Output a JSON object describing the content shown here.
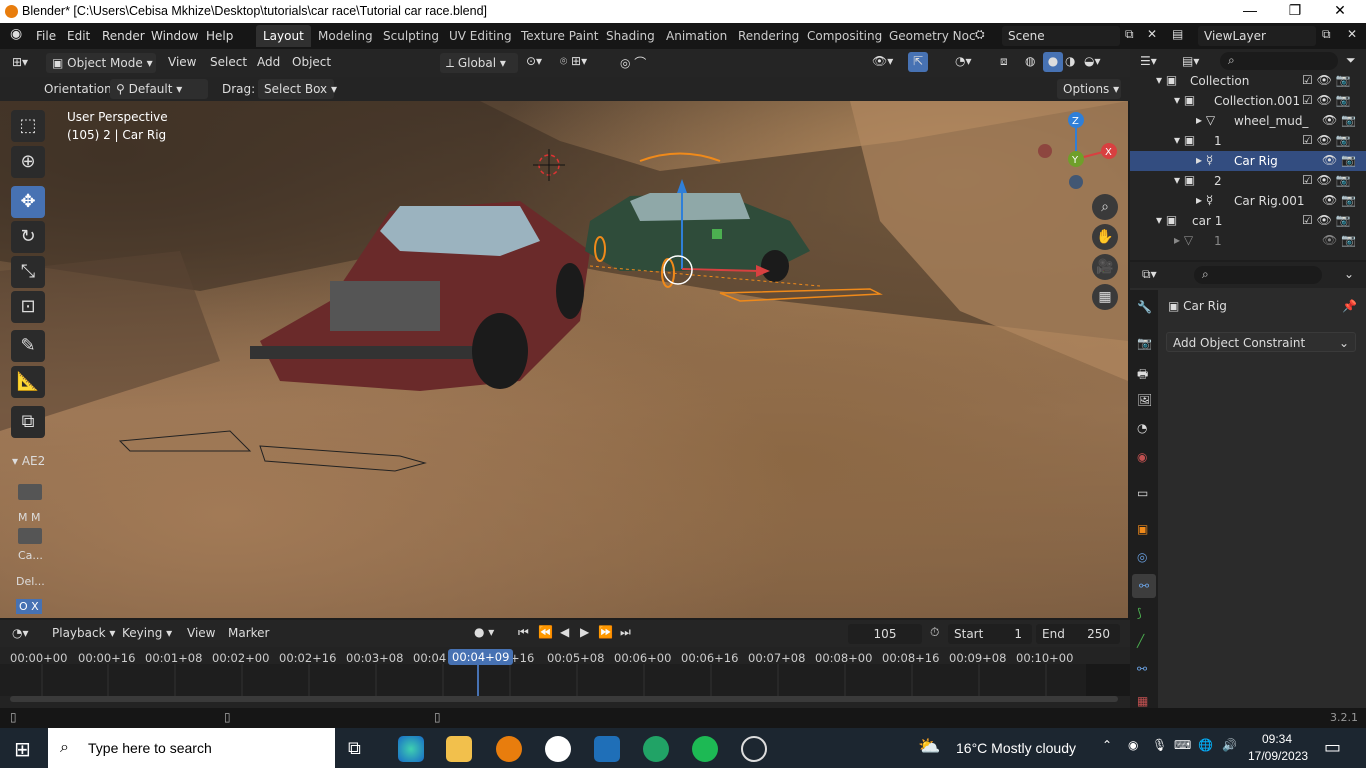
{
  "window": {
    "title": "Blender* [C:\\Users\\Cebisa Mkhize\\Desktop\\tutorials\\car race\\Tutorial car race.blend]"
  },
  "menu": [
    "File",
    "Edit",
    "Render",
    "Window",
    "Help"
  ],
  "workspaces": [
    "Layout",
    "Modeling",
    "Sculpting",
    "UV Editing",
    "Texture Paint",
    "Shading",
    "Animation",
    "Rendering",
    "Compositing",
    "Geometry Noc"
  ],
  "scene": "Scene",
  "view_layer": "ViewLayer",
  "viewport": {
    "mode": "Object Mode",
    "menu": [
      "View",
      "Select",
      "Add",
      "Object"
    ],
    "transform": "Global",
    "orientation_label": "Orientation:",
    "orientation": "Default",
    "drag_label": "Drag:",
    "drag": "Select Box",
    "options": "Options",
    "overlay_title": "User Perspective",
    "overlay_sub": "(105) 2 | Car Rig",
    "gizmo": {
      "z": "Z",
      "y": "Y",
      "x": "X"
    }
  },
  "tool_panel": {
    "title": "AE2",
    "items": [
      "M M",
      "Ca...",
      "Del...",
      "O X"
    ]
  },
  "outliner": {
    "rows": [
      {
        "label": "Collection",
        "level": 1
      },
      {
        "label": "Collection.001",
        "level": 2
      },
      {
        "label": "wheel_mud_",
        "level": 3
      },
      {
        "label": "1",
        "level": 2
      },
      {
        "label": "Car Rig",
        "level": 3,
        "selected": true
      },
      {
        "label": "2",
        "level": 2
      },
      {
        "label": "Car Rig.001",
        "level": 3
      },
      {
        "label": "car 1",
        "level": 1
      },
      {
        "label": "1",
        "level": 2
      }
    ]
  },
  "properties": {
    "object": "Car Rig",
    "constraint": "Add Object Constraint"
  },
  "timeline": {
    "menus": [
      "Playback",
      "Keying",
      "View",
      "Marker"
    ],
    "frame": "105",
    "start_label": "Start",
    "start": "1",
    "end_label": "End",
    "end": "250",
    "current": "00:04+09",
    "ticks": [
      "00:00+00",
      "00:00+16",
      "00:01+08",
      "00:02+00",
      "00:02+16",
      "00:03+08",
      "00:04",
      "+16",
      "00:05+08",
      "00:06+00",
      "00:06+16",
      "00:07+08",
      "00:08+00",
      "00:08+16",
      "00:09+08",
      "00:10+00"
    ]
  },
  "status": {
    "version": "3.2.1"
  },
  "taskbar": {
    "search": "Type here to search",
    "weather": "16°C  Mostly cloudy",
    "time": "09:34",
    "date": "17/09/2023"
  },
  "colors": {
    "accent": "#4772b3",
    "selection": "#334d80",
    "blender_orange": "#e87d0d"
  }
}
